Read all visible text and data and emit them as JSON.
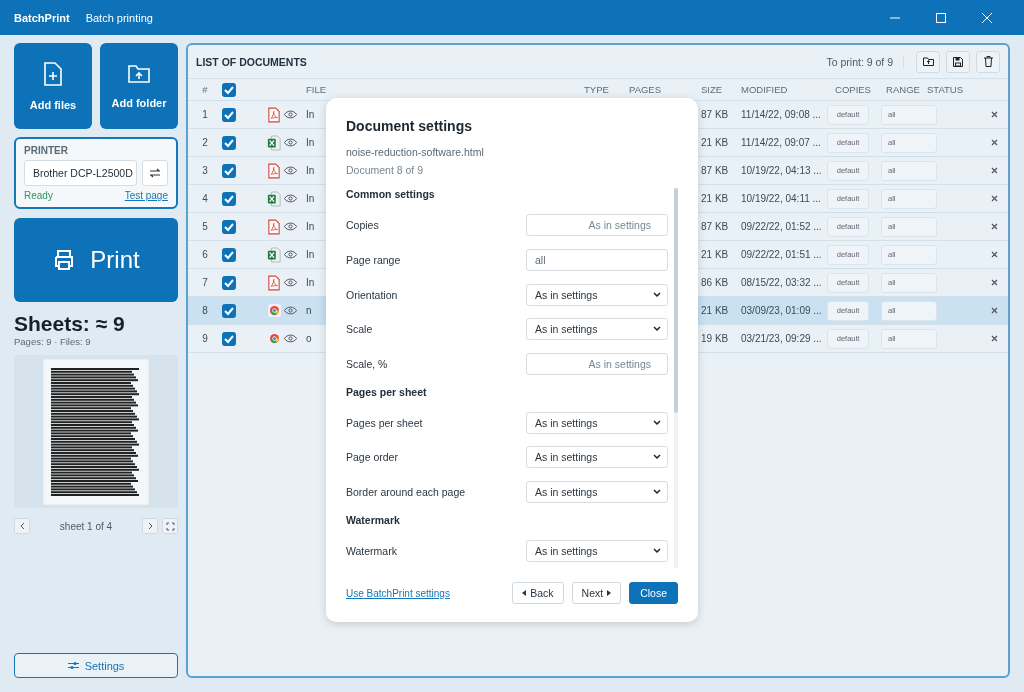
{
  "app": {
    "name": "BatchPrint",
    "subtitle": "Batch printing"
  },
  "sidebar": {
    "add_buttons": [
      {
        "label": "Add files",
        "kind": "file"
      },
      {
        "label": "Add folder",
        "kind": "folder"
      }
    ],
    "printer": {
      "heading": "PRINTER",
      "name": "Brother DCP-L2500D",
      "status": "Ready",
      "test_link": "Test page"
    },
    "print_button": "Print",
    "sheets": "Sheets: ≈ 9",
    "summary": "Pages: 9 · Files: 9",
    "preview": {
      "sheet_label": "sheet 1 of 4"
    },
    "settings_button": "Settings"
  },
  "documents": {
    "title": "LIST OF DOCUMENTS",
    "to_print": "To print: 9 of 9",
    "all_checked": true,
    "columns": [
      "#",
      "FILE",
      "TYPE",
      "PAGES",
      "SIZE",
      "MODIFIED",
      "COPIES",
      "RANGE",
      "STATUS"
    ],
    "rows": [
      {
        "num": "1",
        "checked": true,
        "kind": "pdf",
        "file": "In",
        "size": "87 KB",
        "modified": "11/14/22, 09:08 ...",
        "copies": "default",
        "range": "all",
        "selected": false
      },
      {
        "num": "2",
        "checked": true,
        "kind": "excel",
        "file": "In",
        "size": "21 KB",
        "modified": "11/14/22, 09:07 ...",
        "copies": "default",
        "range": "all",
        "selected": false
      },
      {
        "num": "3",
        "checked": true,
        "kind": "pdf",
        "file": "In",
        "size": "87 KB",
        "modified": "10/19/22, 04:13 ...",
        "copies": "default",
        "range": "all",
        "selected": false
      },
      {
        "num": "4",
        "checked": true,
        "kind": "excel",
        "file": "In",
        "size": "21 KB",
        "modified": "10/19/22, 04:11 ...",
        "copies": "default",
        "range": "all",
        "selected": false
      },
      {
        "num": "5",
        "checked": true,
        "kind": "pdf",
        "file": "In",
        "size": "87 KB",
        "modified": "09/22/22, 01:52 ...",
        "copies": "default",
        "range": "all",
        "selected": false
      },
      {
        "num": "6",
        "checked": true,
        "kind": "excel",
        "file": "In",
        "size": "21 KB",
        "modified": "09/22/22, 01:51 ...",
        "copies": "default",
        "range": "all",
        "selected": false
      },
      {
        "num": "7",
        "checked": true,
        "kind": "pdf",
        "file": "In",
        "size": "86 KB",
        "modified": "08/15/22, 03:32 ...",
        "copies": "default",
        "range": "all",
        "selected": false
      },
      {
        "num": "8",
        "checked": true,
        "kind": "web",
        "file": "n",
        "size": "21 KB",
        "modified": "03/09/23, 01:09 ...",
        "copies": "default",
        "range": "all",
        "selected": true
      },
      {
        "num": "9",
        "checked": true,
        "kind": "web",
        "file": "o",
        "size": "19 KB",
        "modified": "03/21/23, 09:29 ...",
        "copies": "default",
        "range": "all",
        "selected": false
      }
    ]
  },
  "dialog": {
    "title": "Document settings",
    "file": "noise-reduction-software.html",
    "position": "Document 8 of 9",
    "fields": [
      {
        "kind": "heading",
        "label": "Common settings"
      },
      {
        "kind": "input",
        "label": "Copies",
        "placeholder": "As in settings"
      },
      {
        "kind": "input",
        "label": "Page range",
        "value": "all"
      },
      {
        "kind": "select",
        "label": "Orientation",
        "value": "As in settings"
      },
      {
        "kind": "select",
        "label": "Scale",
        "value": "As in settings"
      },
      {
        "kind": "input",
        "label": "Scale, %",
        "placeholder": "As in settings"
      },
      {
        "kind": "heading",
        "label": "Pages per sheet"
      },
      {
        "kind": "select",
        "label": "Pages per sheet",
        "value": "As in settings"
      },
      {
        "kind": "select",
        "label": "Page order",
        "value": "As in settings"
      },
      {
        "kind": "select",
        "label": "Border around each page",
        "value": "As in settings"
      },
      {
        "kind": "heading",
        "label": "Watermark"
      },
      {
        "kind": "select",
        "label": "Watermark",
        "value": "As in settings"
      }
    ],
    "link": "Use BatchPrint settings",
    "buttons": [
      {
        "label": "Back",
        "kind": "back"
      },
      {
        "label": "Next",
        "kind": "next"
      },
      {
        "label": "Close",
        "kind": "primary"
      }
    ]
  }
}
